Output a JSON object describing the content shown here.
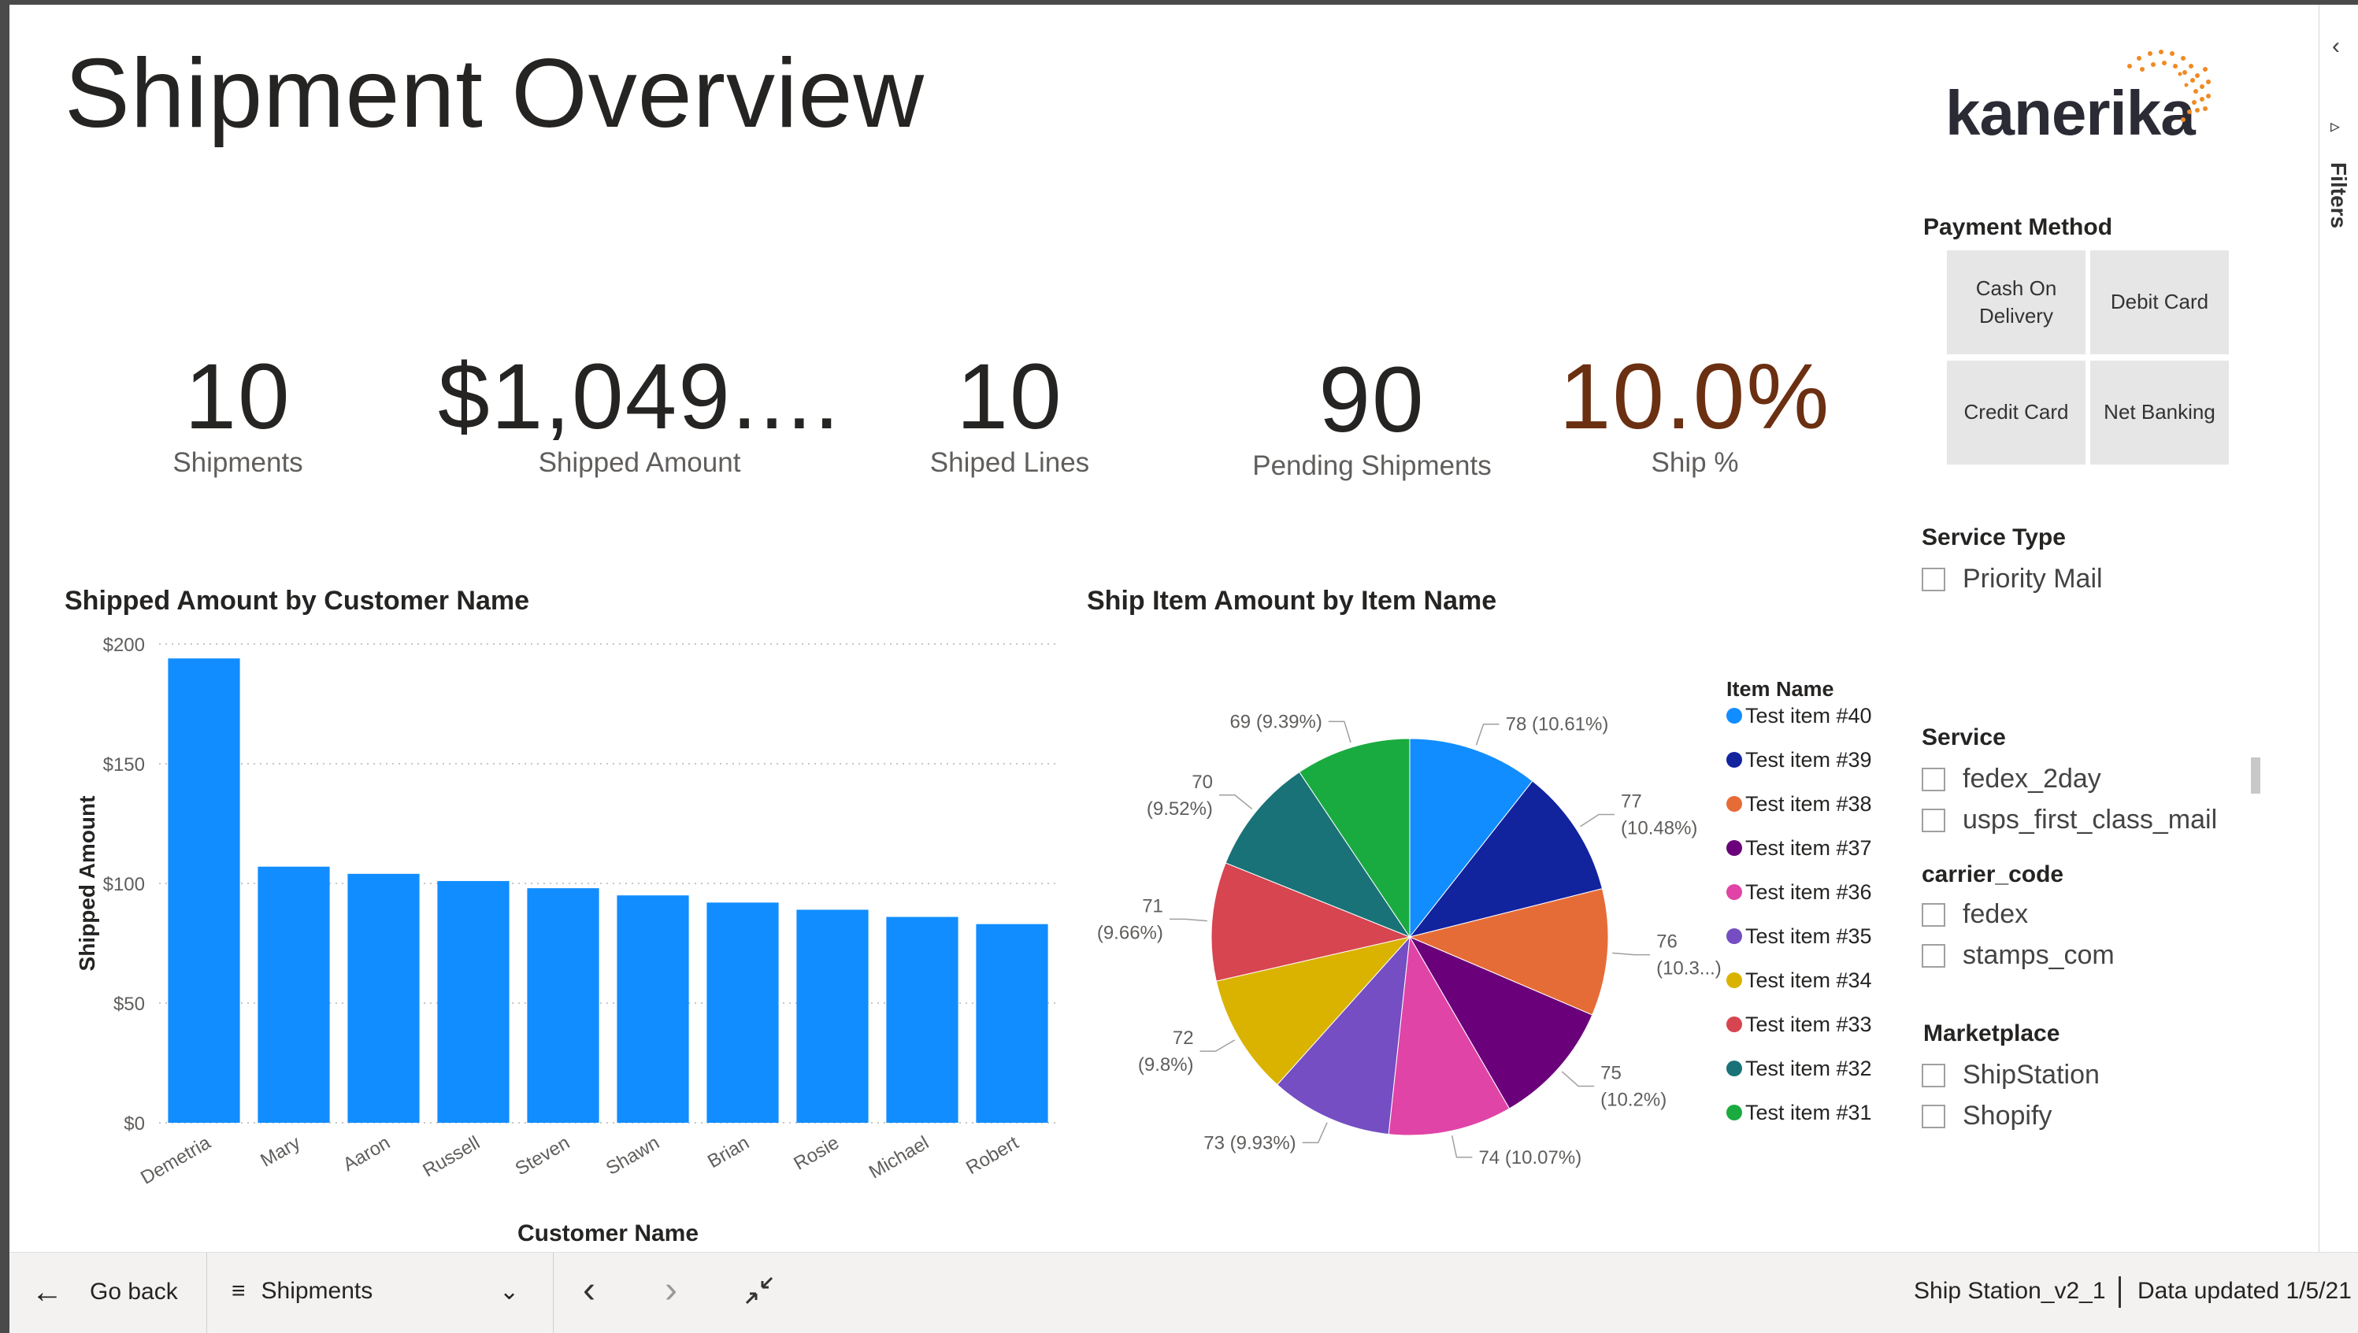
{
  "title": "Shipment Overview",
  "logo_text": "kanerika",
  "kpis": [
    {
      "value": "10",
      "label": "Shipments",
      "color": "#252423"
    },
    {
      "value": "$1,049....",
      "label": "Shipped Amount",
      "color": "#252423"
    },
    {
      "value": "10",
      "label": "Shiped Lines",
      "color": "#252423"
    },
    {
      "value": "90",
      "label": "Pending Shipments",
      "color": "#252423"
    },
    {
      "value": "10.0%",
      "label": "Ship %",
      "color": "#6b2f12"
    }
  ],
  "payment_method": {
    "title": "Payment Method",
    "options": [
      "Cash On Delivery",
      "Debit Card",
      "Credit Card",
      "Net Banking"
    ]
  },
  "service_type": {
    "title": "Service Type",
    "options": [
      "Priority Mail"
    ]
  },
  "service": {
    "title": "Service",
    "options": [
      "fedex_2day",
      "usps_first_class_mail"
    ]
  },
  "carrier_code": {
    "title": "carrier_code",
    "options": [
      "fedex",
      "stamps_com"
    ]
  },
  "marketplace": {
    "title": "Marketplace",
    "options": [
      "ShipStation",
      "Shopify"
    ]
  },
  "filters_pane": {
    "label": "Filters"
  },
  "footer": {
    "go_back": "Go back",
    "page_name": "Shipments",
    "report_name": "Ship Station_v2_1",
    "data_updated": "Data updated 1/5/21"
  },
  "chart_data": [
    {
      "type": "bar",
      "title": "Shipped Amount by Customer Name",
      "xlabel": "Customer Name",
      "ylabel": "Shipped Amount",
      "categories": [
        "Demetria",
        "Mary",
        "Aaron",
        "Russell",
        "Steven",
        "Shawn",
        "Brian",
        "Rosie",
        "Michael",
        "Robert"
      ],
      "values": [
        194,
        107,
        104,
        101,
        98,
        95,
        92,
        89,
        86,
        83
      ],
      "ylim": [
        0,
        200
      ],
      "yticks": [
        "$0",
        "$50",
        "$100",
        "$150",
        "$200"
      ],
      "color": "#118dff",
      "grid": true
    },
    {
      "type": "pie",
      "title": "Ship Item Amount by Item Name",
      "legend_title": "Item Name",
      "legend_position": "right",
      "slices": [
        {
          "name": "Test item #40",
          "value": 78,
          "label": [
            "78 (10.61%)"
          ],
          "color": "#118dff"
        },
        {
          "name": "Test item #39",
          "value": 77,
          "label": [
            "77",
            "(10.48%)"
          ],
          "color": "#12239e"
        },
        {
          "name": "Test item #38",
          "value": 76,
          "label": [
            "76",
            "(10.3...)"
          ],
          "color": "#e66c37"
        },
        {
          "name": "Test item #37",
          "value": 75,
          "label": [
            "75",
            "(10.2%)"
          ],
          "color": "#6b007b"
        },
        {
          "name": "Test item #36",
          "value": 74,
          "label": [
            "74 (10.07%)"
          ],
          "color": "#e044a7"
        },
        {
          "name": "Test item #35",
          "value": 73,
          "label": [
            "73 (9.93%)"
          ],
          "color": "#744ec2"
        },
        {
          "name": "Test item #34",
          "value": 72,
          "label": [
            "72",
            "(9.8%)"
          ],
          "color": "#d9b300"
        },
        {
          "name": "Test item #33",
          "value": 71,
          "label": [
            "71",
            "(9.66%)"
          ],
          "color": "#d64550"
        },
        {
          "name": "Test item #32",
          "value": 70,
          "label": [
            "70",
            "(9.52%)"
          ],
          "color": "#197278"
        },
        {
          "name": "Test item #31",
          "value": 69,
          "label": [
            "69 (9.39%)"
          ],
          "color": "#1aab40"
        }
      ]
    }
  ]
}
